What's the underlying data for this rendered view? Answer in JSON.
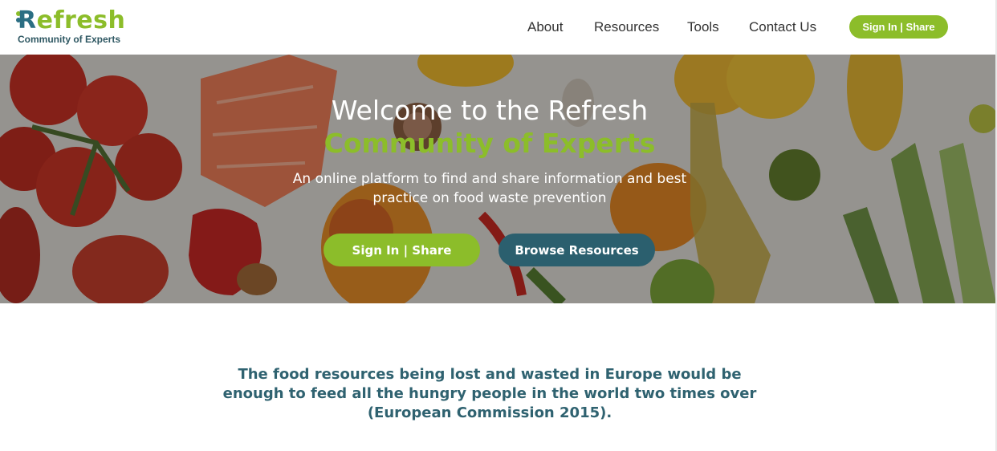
{
  "brand": {
    "logo_text_r": "R",
    "logo_text_rest": "efresh",
    "tagline": "Community of Experts",
    "colors": {
      "green": "#8cbd2a",
      "teal": "#2b6e83",
      "dark_teal": "#2b5f6e"
    }
  },
  "nav": {
    "items": [
      {
        "label": "About"
      },
      {
        "label": "Resources"
      },
      {
        "label": "Tools"
      },
      {
        "label": "Contact Us"
      }
    ],
    "signin_label": "Sign In | Share"
  },
  "hero": {
    "title_line1": "Welcome to the Refresh",
    "title_line2": "Community of Experts",
    "subtitle_line1": "An online platform to find and share information and best",
    "subtitle_line2": "practice on food waste prevention",
    "signin_label": "Sign In | Share",
    "browse_label": "Browse Resources"
  },
  "quote": {
    "line1": "The food resources being lost and wasted in Europe would be",
    "line2": "enough to feed all the hungry people in the world two times over",
    "line3": "(European Commission 2015)."
  }
}
